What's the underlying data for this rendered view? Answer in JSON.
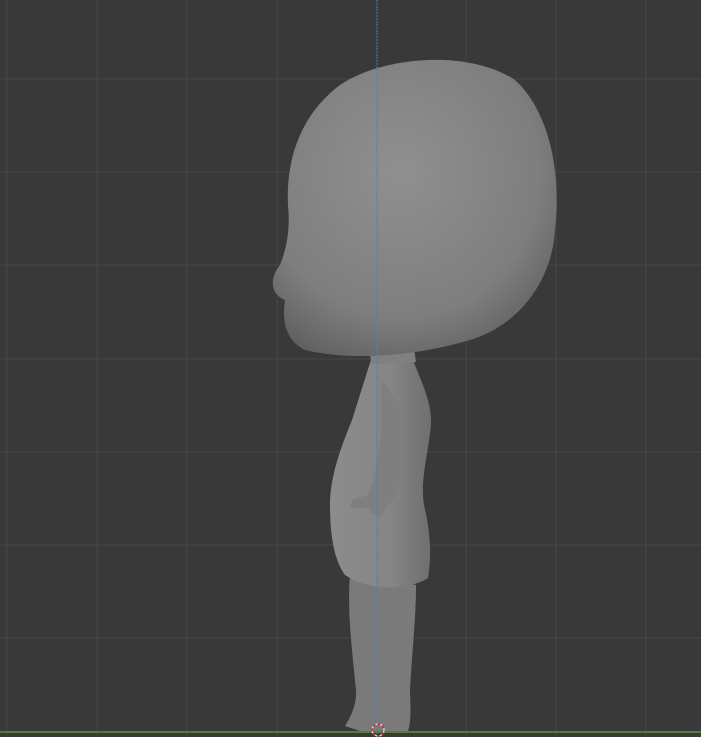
{
  "viewport": {
    "view": "side",
    "background_color": "#393939",
    "grid_color": "#4a4a4a",
    "axis_z_color": "#4d7fb3",
    "ground_axis_color": "#5a7a3a",
    "model_color": "#8a8a8a"
  },
  "icons": {
    "origin": "3d-cursor-icon"
  }
}
